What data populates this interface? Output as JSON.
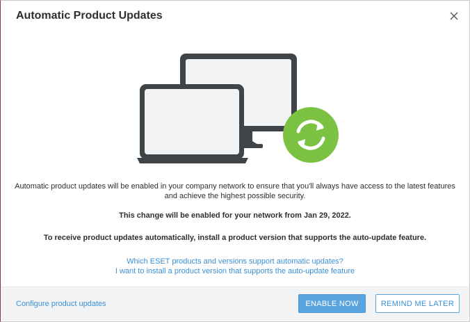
{
  "dialog": {
    "title": "Automatic Product Updates",
    "close_icon": "close-icon"
  },
  "illustration": {
    "icons": [
      "monitor-icon",
      "laptop-icon",
      "refresh-icon"
    ],
    "colors": {
      "device": "#3f4449",
      "screen": "#f2f3f5",
      "badge": "#7bc142"
    }
  },
  "content": {
    "description": "Automatic product updates will be enabled in your company network to ensure that you'll always have access to the latest features and achieve the highest possible security.",
    "enable_date_notice": "This change will be enabled for your network from Jan 29, 2022.",
    "install_notice": "To receive product updates automatically, install a product version that supports the auto-update feature.",
    "links": [
      "Which ESET products and versions support automatic updates?",
      "I want to install a product version that supports the auto-update feature"
    ]
  },
  "footer": {
    "configure_link": "Configure product updates",
    "enable_button": "ENABLE NOW",
    "remind_button": "REMIND ME LATER"
  }
}
